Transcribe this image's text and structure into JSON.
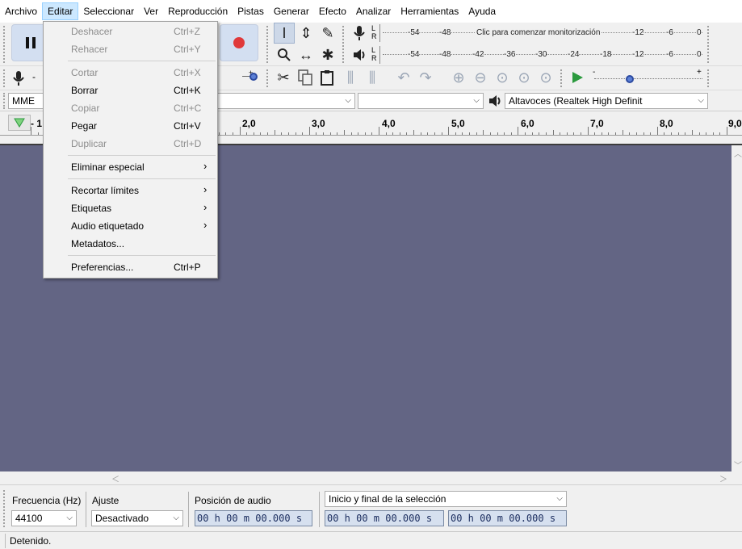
{
  "menubar": {
    "items": [
      "Archivo",
      "Editar",
      "Seleccionar",
      "Ver",
      "Reproducción",
      "Pistas",
      "Generar",
      "Efecto",
      "Analizar",
      "Herramientas",
      "Ayuda"
    ],
    "active": "Editar"
  },
  "edit_menu": {
    "items": [
      {
        "label": "Deshacer",
        "shortcut": "Ctrl+Z",
        "enabled": false
      },
      {
        "label": "Rehacer",
        "shortcut": "Ctrl+Y",
        "enabled": false
      },
      {
        "label": "Cortar",
        "shortcut": "Ctrl+X",
        "enabled": false
      },
      {
        "label": "Borrar",
        "shortcut": "Ctrl+K",
        "enabled": true
      },
      {
        "label": "Copiar",
        "shortcut": "Ctrl+C",
        "enabled": false
      },
      {
        "label": "Pegar",
        "shortcut": "Ctrl+V",
        "enabled": true
      },
      {
        "label": "Duplicar",
        "shortcut": "Ctrl+D",
        "enabled": false
      },
      {
        "label": "Eliminar especial",
        "submenu": true,
        "enabled": true
      },
      {
        "label": "Recortar límites",
        "submenu": true,
        "enabled": true
      },
      {
        "label": "Etiquetas",
        "submenu": true,
        "enabled": true
      },
      {
        "label": "Audio etiquetado",
        "submenu": true,
        "enabled": true
      },
      {
        "label": "Metadatos...",
        "enabled": true
      },
      {
        "label": "Preferencias...",
        "shortcut": "Ctrl+P",
        "enabled": true
      }
    ]
  },
  "meters": {
    "record_lr": [
      "L",
      "R"
    ],
    "play_lr": [
      "L",
      "R"
    ],
    "record_ticks": [
      "-54",
      "-48",
      "-12",
      "-6",
      "0"
    ],
    "record_prompt": "Clic para comenzar monitorización",
    "play_ticks": [
      "-54",
      "-48",
      "-42",
      "-36",
      "-30",
      "-24",
      "-18",
      "-12",
      "-6",
      "0"
    ]
  },
  "sliders": {
    "plus": "+",
    "minus": "-"
  },
  "device": {
    "host": "MME",
    "output": "Altavoces (Realtek High Definit"
  },
  "ruler": {
    "start_label": "- 1",
    "labels": [
      "2,0",
      "3,0",
      "4,0",
      "5,0",
      "6,0",
      "7,0",
      "8,0",
      "9,0"
    ]
  },
  "selection": {
    "rate_label": "Frecuencia (Hz)",
    "rate_value": "44100",
    "snap_label": "Ajuste",
    "snap_value": "Desactivado",
    "position_label": "Posición de audio",
    "position_value": "00 h 00 m 00.000 s",
    "range_label": "Inicio y final de la selección",
    "start_value": "00 h 00 m 00.000 s",
    "end_value": "00 h 00 m 00.000 s"
  },
  "status": {
    "text": "Detenido."
  },
  "colors": {
    "track_bg": "#636584",
    "record": "#e0393a",
    "play": "#2b9a3e"
  }
}
